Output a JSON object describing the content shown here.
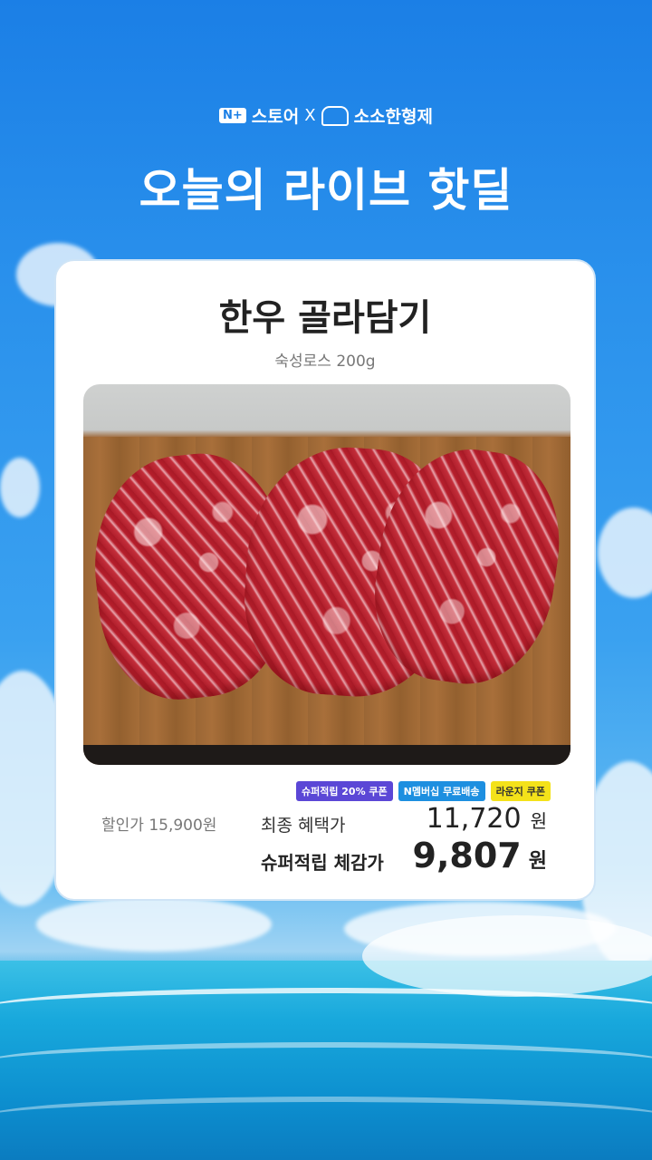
{
  "header": {
    "store_logo": "N+",
    "store_name": "스토어",
    "separator": "X",
    "partner_name": "소소한형제",
    "headline": "오늘의 라이브 핫딜"
  },
  "product": {
    "title": "한우 골라담기",
    "subtitle": "숙성로스 200g",
    "image_alt": "marbled raw beef slices on wooden board"
  },
  "badges": [
    {
      "label": "슈퍼적립 20% 쿠폰",
      "color": "#5b47d6"
    },
    {
      "label": "N멤버십 무료배송",
      "color": "#1d8fe0"
    },
    {
      "label": "라운지 쿠폰",
      "color": "#f4e21a"
    }
  ],
  "pricing": {
    "discount_label": "할인가 15,900원",
    "final_label": "최종 혜택가",
    "final_value": "11,720",
    "final_unit": "원",
    "super_label": "슈퍼적립 체감가",
    "super_value": "9,807",
    "super_unit": "원"
  }
}
